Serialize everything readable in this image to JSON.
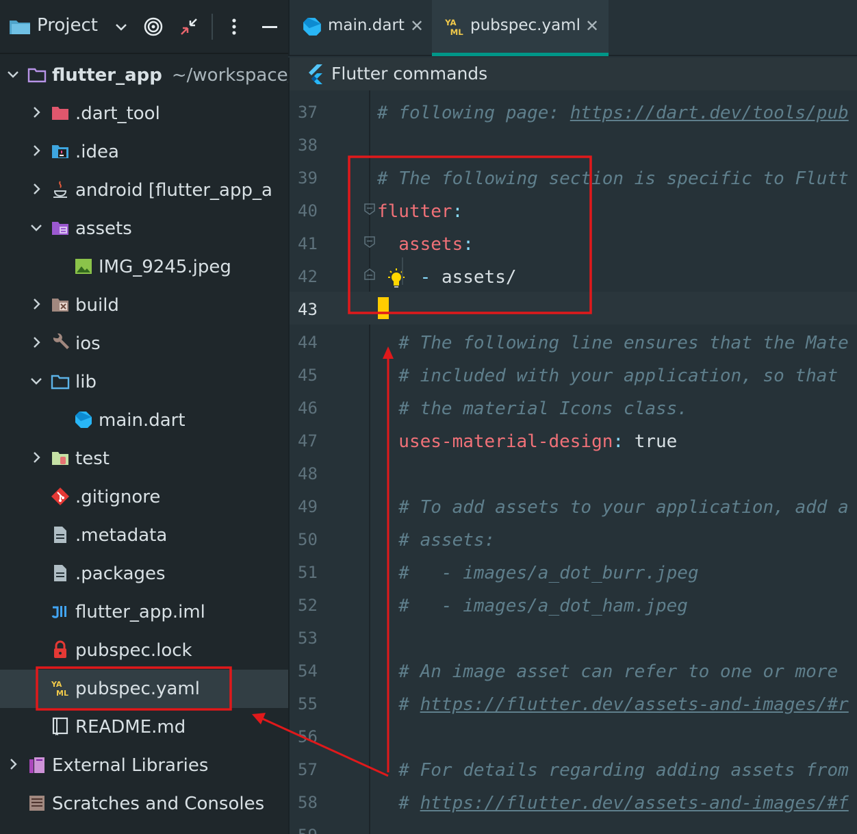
{
  "project_panel": {
    "title": "Project",
    "header_icons": [
      "chevron-down-icon",
      "target-icon",
      "collapse-icon",
      "more-vertical-icon",
      "minimize-icon"
    ],
    "tree": [
      {
        "label": "flutter_app",
        "path": "~/workspace/",
        "icon": "folder-icon",
        "expanded": true,
        "level": 0,
        "bold": true
      },
      {
        "label": ".dart_tool",
        "icon": "folder-red-icon",
        "expanded": false,
        "level": 1
      },
      {
        "label": ".idea",
        "icon": "idea-folder-icon",
        "expanded": false,
        "level": 1
      },
      {
        "label": "android [flutter_app_a",
        "icon": "java-icon",
        "expanded": false,
        "level": 1
      },
      {
        "label": "assets",
        "icon": "assets-folder-icon",
        "expanded": true,
        "level": 1
      },
      {
        "label": "IMG_9245.jpeg",
        "icon": "image-file-icon",
        "level": 2
      },
      {
        "label": "build",
        "icon": "build-folder-icon",
        "expanded": false,
        "level": 1
      },
      {
        "label": "ios",
        "icon": "wrench-icon",
        "expanded": false,
        "level": 1
      },
      {
        "label": "lib",
        "icon": "folder-outline-icon",
        "expanded": true,
        "level": 1
      },
      {
        "label": "main.dart",
        "icon": "dart-icon",
        "level": 2
      },
      {
        "label": "test",
        "icon": "test-folder-icon",
        "expanded": false,
        "level": 1
      },
      {
        "label": ".gitignore",
        "icon": "git-icon",
        "level": 1
      },
      {
        "label": ".metadata",
        "icon": "file-icon",
        "level": 1
      },
      {
        "label": ".packages",
        "icon": "file-icon",
        "level": 1
      },
      {
        "label": "flutter_app.iml",
        "icon": "iml-icon",
        "level": 1
      },
      {
        "label": "pubspec.lock",
        "icon": "lock-icon",
        "level": 1
      },
      {
        "label": "pubspec.yaml",
        "icon": "yaml-icon",
        "level": 1,
        "selected": true
      },
      {
        "label": "README.md",
        "icon": "readme-icon",
        "level": 1
      },
      {
        "label": "External Libraries",
        "icon": "library-icon",
        "expanded": false,
        "level": 0
      },
      {
        "label": "Scratches and Consoles",
        "icon": "scratches-icon",
        "level": 0
      }
    ]
  },
  "tabs": [
    {
      "label": "main.dart",
      "icon": "dart-icon",
      "active": false
    },
    {
      "label": "pubspec.yaml",
      "icon": "yaml-icon",
      "active": true
    }
  ],
  "command_bar": {
    "label": "Flutter commands",
    "icon": "flutter-icon"
  },
  "editor": {
    "current_line": 43,
    "lines": [
      {
        "n": "37",
        "parts": [
          {
            "t": "# following page: ",
            "c": "cmt"
          },
          {
            "t": "https://dart.dev/tools/pub",
            "c": "url"
          }
        ]
      },
      {
        "n": "38",
        "parts": []
      },
      {
        "n": "39",
        "parts": [
          {
            "t": "# The following section is specific to Flutt",
            "c": "cmt"
          }
        ]
      },
      {
        "n": "40",
        "parts": [
          {
            "t": "flutter",
            "c": "key"
          },
          {
            "t": ":",
            "c": "colon"
          }
        ]
      },
      {
        "n": "41",
        "parts": [
          {
            "t": "  assets",
            "c": "key"
          },
          {
            "t": ":",
            "c": "colon"
          }
        ]
      },
      {
        "n": "42",
        "parts": [
          {
            "t": "    ",
            "c": "val"
          },
          {
            "t": "- ",
            "c": "dash"
          },
          {
            "t": "assets/",
            "c": "val"
          }
        ]
      },
      {
        "n": "43",
        "parts": []
      },
      {
        "n": "44",
        "parts": [
          {
            "t": "  # The following line ensures that the Mate",
            "c": "cmt"
          }
        ]
      },
      {
        "n": "45",
        "parts": [
          {
            "t": "  # included with your application, so that",
            "c": "cmt"
          }
        ]
      },
      {
        "n": "46",
        "parts": [
          {
            "t": "  # the material Icons class.",
            "c": "cmt"
          }
        ]
      },
      {
        "n": "47",
        "parts": [
          {
            "t": "  uses-material-design",
            "c": "key"
          },
          {
            "t": ": ",
            "c": "colon"
          },
          {
            "t": "true",
            "c": "val"
          }
        ]
      },
      {
        "n": "48",
        "parts": []
      },
      {
        "n": "49",
        "parts": [
          {
            "t": "  # To add assets to your application, add a",
            "c": "cmt"
          }
        ]
      },
      {
        "n": "50",
        "parts": [
          {
            "t": "  # assets:",
            "c": "cmt"
          }
        ]
      },
      {
        "n": "51",
        "parts": [
          {
            "t": "  #   - images/a_dot_burr.jpeg",
            "c": "cmt"
          }
        ]
      },
      {
        "n": "52",
        "parts": [
          {
            "t": "  #   - images/a_dot_ham.jpeg",
            "c": "cmt"
          }
        ]
      },
      {
        "n": "53",
        "parts": []
      },
      {
        "n": "54",
        "parts": [
          {
            "t": "  # An image asset can refer to one or more",
            "c": "cmt"
          }
        ]
      },
      {
        "n": "55",
        "parts": [
          {
            "t": "  # ",
            "c": "cmt"
          },
          {
            "t": "https://flutter.dev/assets-and-images/#r",
            "c": "url"
          }
        ]
      },
      {
        "n": "56",
        "parts": []
      },
      {
        "n": "57",
        "parts": [
          {
            "t": "  # For details regarding adding assets from",
            "c": "cmt"
          }
        ]
      },
      {
        "n": "58",
        "parts": [
          {
            "t": "  # ",
            "c": "cmt"
          },
          {
            "t": "https://flutter.dev/assets-and-images/#f",
            "c": "url"
          }
        ]
      },
      {
        "n": "59",
        "parts": []
      }
    ]
  },
  "annotation_color": "#e0191b"
}
